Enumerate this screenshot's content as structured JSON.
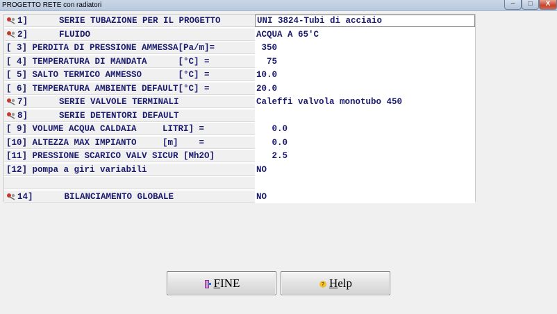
{
  "window": {
    "title": "PROGETTO RETE con radiatori",
    "minimize": "–",
    "maximize": "□",
    "close": "X"
  },
  "rows": [
    {
      "label": "1]      SERIE TUBAZIONE PER IL PROGETTO",
      "value": "UNI 3824-Tubi di acciaio",
      "pin": true,
      "boxed": true
    },
    {
      "label": "2]      FLUIDO",
      "value": "ACQUA A 65'C",
      "pin": true,
      "boxed": false
    },
    {
      "label": "[ 3] PERDITA DI PRESSIONE AMMESSA[Pa/m]=",
      "value": " 350",
      "pin": false,
      "boxed": false
    },
    {
      "label": "[ 4] TEMPERATURA DI MANDATA      [°C] =",
      "value": "  75",
      "pin": false,
      "boxed": false
    },
    {
      "label": "[ 5] SALTO TERMICO AMMESSO       [°C] =",
      "value": "10.0",
      "pin": false,
      "boxed": false
    },
    {
      "label": "[ 6] TEMPERATURA AMBIENTE DEFAULT[°C] =",
      "value": "20.0",
      "pin": false,
      "boxed": false
    },
    {
      "label": "7]      SERIE VALVOLE TERMINALI",
      "value": "Caleffi valvola monotubo 450",
      "pin": true,
      "boxed": false
    },
    {
      "label": "8]      SERIE DETENTORI DEFAULT",
      "value": "",
      "pin": true,
      "boxed": false
    },
    {
      "label": "[ 9] VOLUME ACQUA CALDAIA     LITRI] =",
      "value": "   0.0",
      "pin": false,
      "boxed": false
    },
    {
      "label": "[10] ALTEZZA MAX IMPIANTO     [m]    =",
      "value": "   0.0",
      "pin": false,
      "boxed": false
    },
    {
      "label": "[11] PRESSIONE SCARICO VALV SICUR [Mh2O]",
      "value": "   2.5",
      "pin": false,
      "boxed": false
    },
    {
      "label": "[12] pompa a giri variabili",
      "value": "NO",
      "pin": false,
      "boxed": false
    },
    {
      "label": "",
      "value": "",
      "pin": false,
      "boxed": false
    },
    {
      "label": "14]      BILANCIAMENTO GLOBALE",
      "value": "NO",
      "pin": true,
      "boxed": false
    }
  ],
  "buttons": {
    "fine": {
      "accel": "F",
      "rest": "INE",
      "icon": "exit-door-icon"
    },
    "help": {
      "accel": "H",
      "rest": "elp",
      "icon": "help-icon"
    }
  },
  "colors": {
    "text": "#1a1a6e",
    "label_bg": "#f0f0f0",
    "value_bg": "#ffffff"
  }
}
